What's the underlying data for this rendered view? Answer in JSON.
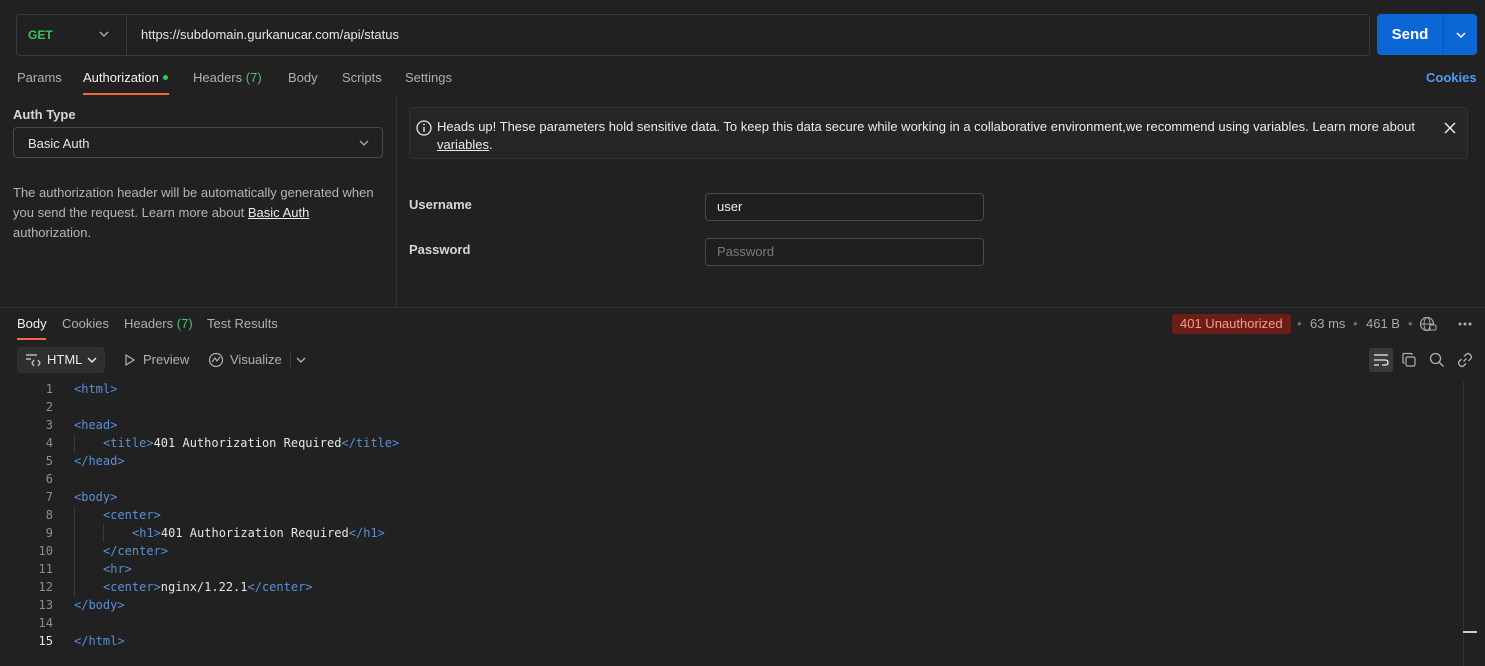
{
  "request": {
    "method": "GET",
    "url": "https://subdomain.gurkanucar.com/api/status",
    "send_label": "Send"
  },
  "request_tabs": {
    "params": "Params",
    "authorization": "Authorization",
    "headers": "Headers",
    "headers_count": "(7)",
    "body": "Body",
    "scripts": "Scripts",
    "settings": "Settings",
    "cookies": "Cookies"
  },
  "auth": {
    "type_label": "Auth Type",
    "type_value": "Basic Auth",
    "desc_1": "The authorization header will be automatically generated when you send the request. Learn more about",
    "desc_link": "Basic Auth",
    "desc_2": "authorization."
  },
  "banner": {
    "text": "Heads up! These parameters hold sensitive data. To keep this data secure while working in a collaborative environment,we recommend using variables. Learn more about",
    "link": "variables",
    "end": "."
  },
  "fields": {
    "username_label": "Username",
    "username_value": "user",
    "password_label": "Password",
    "password_placeholder": "Password"
  },
  "response_tabs": {
    "body": "Body",
    "cookies": "Cookies",
    "headers": "Headers",
    "headers_count": "(7)",
    "test_results": "Test Results"
  },
  "response_meta": {
    "status": "401 Unauthorized",
    "time": "63 ms",
    "size": "461 B",
    "status_color": "#6b1d17"
  },
  "toolbar": {
    "format": "HTML",
    "preview": "Preview",
    "visualize": "Visualize"
  },
  "code": [
    {
      "n": "1",
      "indent": 0,
      "pre": "<html>",
      "text": "",
      "post": ""
    },
    {
      "n": "2",
      "indent": 0,
      "pre": "",
      "text": "",
      "post": ""
    },
    {
      "n": "3",
      "indent": 0,
      "pre": "<head>",
      "text": "",
      "post": ""
    },
    {
      "n": "4",
      "indent": 1,
      "pre": "<title>",
      "text": "401 Authorization Required",
      "post": "</title>"
    },
    {
      "n": "5",
      "indent": 0,
      "pre": "</head>",
      "text": "",
      "post": ""
    },
    {
      "n": "6",
      "indent": 0,
      "pre": "",
      "text": "",
      "post": ""
    },
    {
      "n": "7",
      "indent": 0,
      "pre": "<body>",
      "text": "",
      "post": ""
    },
    {
      "n": "8",
      "indent": 1,
      "pre": "<center>",
      "text": "",
      "post": ""
    },
    {
      "n": "9",
      "indent": 2,
      "pre": "<h1>",
      "text": "401 Authorization Required",
      "post": "</h1>"
    },
    {
      "n": "10",
      "indent": 1,
      "pre": "</center>",
      "text": "",
      "post": ""
    },
    {
      "n": "11",
      "indent": 1,
      "pre": "<hr>",
      "text": "",
      "post": ""
    },
    {
      "n": "12",
      "indent": 1,
      "pre": "<center>",
      "text": "nginx/1.22.1",
      "post": "</center>"
    },
    {
      "n": "13",
      "indent": 0,
      "pre": "</body>",
      "text": "",
      "post": ""
    },
    {
      "n": "14",
      "indent": 0,
      "pre": "",
      "text": "",
      "post": ""
    },
    {
      "n": "15",
      "indent": 0,
      "pre": "</html>",
      "text": "",
      "post": ""
    }
  ],
  "icons": {
    "method_chevron": "chevron-down-icon",
    "send_chevron": "chevron-down-icon",
    "info": "info-icon",
    "close": "close-icon",
    "globe": "globe-lock-icon",
    "more": "more-icon",
    "wrap": "wrap-lines-icon",
    "copy": "copy-icon",
    "search": "search-icon",
    "link": "link-icon"
  }
}
